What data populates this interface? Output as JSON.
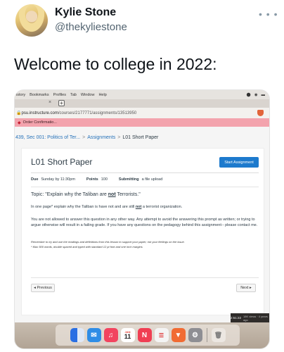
{
  "author": {
    "name": "Kylie Stone",
    "handle": "@thekyliestone"
  },
  "more_icon": "ellipsis-icon",
  "tweet_text": "Welcome to college in 2022:",
  "browser": {
    "menu_items": [
      "istory",
      "Bookmarks",
      "Profiles",
      "Tab",
      "Window",
      "Help"
    ],
    "address": {
      "prefix": "🔒 ",
      "host": "psu.instructure.com",
      "path": "/courses/2177771/assignments/13513950"
    },
    "bookmark": "Order Confirmatio..."
  },
  "canvas": {
    "breadcrumb": {
      "course": "439, Sec 001: Politics of Ter...",
      "section": "Assignments",
      "current": "L01 Short Paper"
    },
    "title": "L01 Short Paper",
    "start_button": "Start Assignment",
    "due_label": "Due",
    "due_value": "Sunday by 11:30pm",
    "points_label": "Points",
    "points_value": "100",
    "submitting_label": "Submitting",
    "submitting_value": "a file upload",
    "topic_prefix": "Topic: \"Explain why the Taliban are ",
    "topic_emph": "not",
    "topic_suffix": " Terrorists.\"",
    "para1_prefix": "In one page* explain why the Taliban is have not and are still ",
    "para1_emph": "not",
    "para1_suffix": " a terrorist organization.",
    "para2": "You are not allowed to answer this question in any other way. Any attempt to avoid the answering this prompt as written; or trying to argue otherwise will result in a failing grade. If you have any questions on the pedagogy behind this assignment-- please contact me.",
    "fine1": "Remember to try and use the readings and definitions from this lesson to support your paper; not your feelings on the issue.",
    "fine2": "* Max 500 words, double spaced and typed with standard 12 pt font and one inch margins",
    "prev_button": "◂ Previous",
    "next_button": "Next ▸",
    "video_time": "2:51:22",
    "video_caption": "18K views · 4 years ago"
  },
  "dock": {
    "calendar_month": "JAN",
    "calendar_day": "11"
  },
  "colors": {
    "accent": "#1d7acd",
    "bookmark_bar": "#f3a3ad"
  }
}
